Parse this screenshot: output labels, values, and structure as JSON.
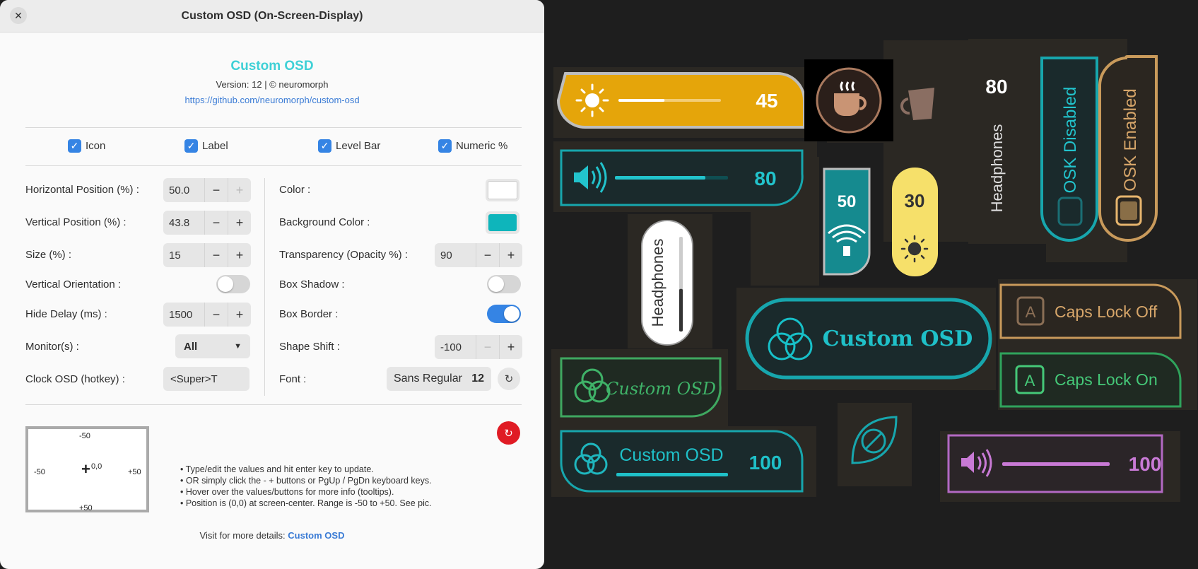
{
  "window": {
    "title": "Custom OSD (On-Screen-Display)",
    "close_glyph": "✕"
  },
  "about": {
    "app_name": "Custom OSD",
    "version": "Version: 12  |  © neuromorph",
    "link": "https://github.com/neuromorph/custom-osd"
  },
  "checkboxes": [
    {
      "label": "Icon",
      "checked": true
    },
    {
      "label": "Label",
      "checked": true
    },
    {
      "label": "Level Bar",
      "checked": true
    },
    {
      "label": "Numeric %",
      "checked": true
    }
  ],
  "left": {
    "hpos": {
      "label": "Horizontal Position (%) :",
      "value": "50.0"
    },
    "vpos": {
      "label": "Vertical Position (%) :",
      "value": "43.8"
    },
    "size": {
      "label": "Size (%) :",
      "value": "15"
    },
    "orientation": {
      "label": "Vertical Orientation :",
      "on": false
    },
    "delay": {
      "label": "Hide Delay (ms) :",
      "value": "1500"
    },
    "monitor": {
      "label": "Monitor(s) :",
      "value": "All"
    },
    "clock": {
      "label": "Clock OSD (hotkey) :",
      "value": "<Super>T"
    }
  },
  "right": {
    "color": {
      "label": "Color :",
      "value": "#ffffff"
    },
    "bgcolor": {
      "label": "Background Color :",
      "value": "#0eb5bb"
    },
    "transparency": {
      "label": "Transparency (Opacity %) :",
      "value": "90"
    },
    "shadow": {
      "label": "Box Shadow :",
      "on": false
    },
    "border": {
      "label": "Box Border :",
      "on": true
    },
    "shift": {
      "label": "Shape Shift :",
      "value": "-100"
    },
    "font": {
      "label": "Font :",
      "name": "Sans Regular",
      "size": "12"
    }
  },
  "spin_glyphs": {
    "minus": "−",
    "plus": "+"
  },
  "diagram": {
    "top": "-50",
    "left": "-50",
    "right": "+50",
    "bottom": "+50",
    "center": "0,0",
    "cross": "+"
  },
  "help": [
    "• Type/edit the values and hit enter key to update.",
    "• OR simply click the - + buttons or PgUp / PgDn keyboard keys.",
    "• Hover over the values/buttons for more info (tooltips).",
    "• Position is (0,0) at screen-center. Range is -50 to +50. See pic."
  ],
  "visit": {
    "text": "Visit for more details: ",
    "link": "Custom OSD"
  },
  "showcase": {
    "brightness": {
      "value": "45",
      "level": 0.45,
      "color": "#e5a50a"
    },
    "volume_teal": {
      "value": "80",
      "level": 0.8
    },
    "headphones_v": {
      "label": "Headphones",
      "level": 0.45
    },
    "wifi": {
      "value": "50"
    },
    "sun_yellow": {
      "value": "30"
    },
    "headphones_num": {
      "value": "80",
      "label": "Headphones"
    },
    "osk_disabled": "OSK Disabled",
    "osk_enabled": "OSK Enabled",
    "custom_big": "Custom OSD",
    "custom_script": "Custom OSD",
    "custom_bar": {
      "label": "Custom OSD",
      "value": "100"
    },
    "caps_off": "Caps Lock Off",
    "caps_on": "Caps Lock On",
    "volume_pink": {
      "value": "100",
      "level": 1.0
    },
    "caps_glyph": "A"
  }
}
